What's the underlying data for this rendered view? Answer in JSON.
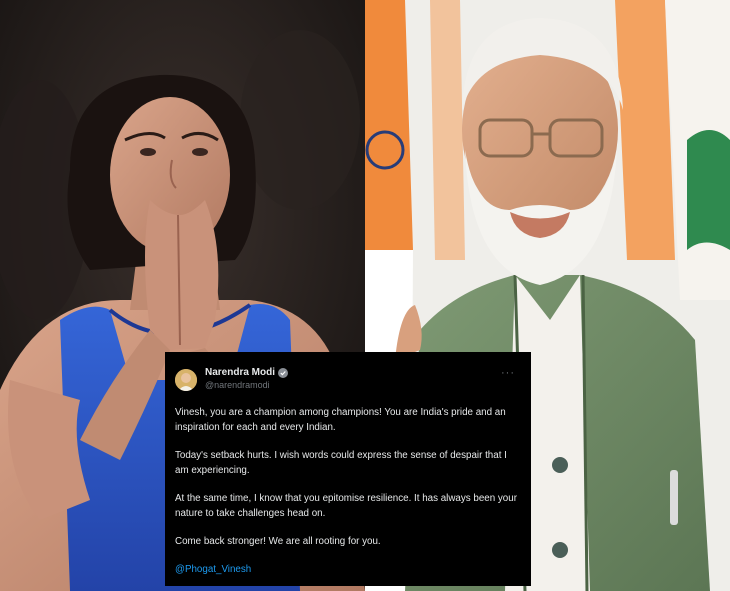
{
  "tweet": {
    "author_name": "Narendra Modi",
    "handle": "@narendramodi",
    "verified_icon": "verified-badge-icon",
    "more_icon": "more-options-icon",
    "paragraphs": [
      "Vinesh, you are a champion among champions! You are India's pride and an inspiration for each and every Indian.",
      "Today's setback hurts. I wish words could express the sense of despair that I am experiencing.",
      "At the same time, I know that you epitomise resilience. It has always been your nature to take challenges head on.",
      "Come back stronger! We are all rooting for you."
    ],
    "mention": "@Phogat_Vinesh"
  },
  "colors": {
    "tweet_background": "#000000",
    "tweet_text": "#e7e9ea",
    "handle_gray": "#71767b",
    "link_blue": "#1d9bf0",
    "singlet_blue": "#2c55c8",
    "flag_saffron": "#f08a3c",
    "flag_green": "#2f8a4f",
    "vest_green": "#6f8a66"
  }
}
